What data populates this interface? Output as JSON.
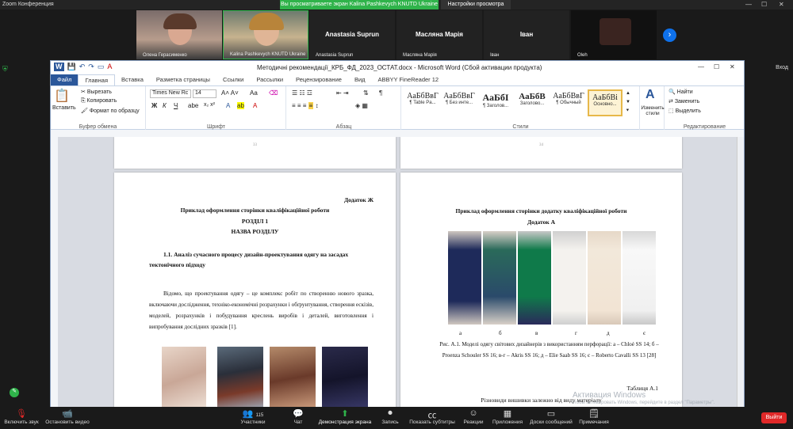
{
  "zoom": {
    "title": "Zoom Конференция",
    "sharing_banner": "Вы просматриваете экран Kalina Pashkevych KNUTD Ukraine",
    "view_options": "Настройки просмотра",
    "right_label": "Вход",
    "participants": [
      {
        "name": "Олена Герасименко"
      },
      {
        "name": "Kalina Pashkevych KNUTD Ukraine"
      },
      {
        "name": "Anastasia Suprun",
        "display": "Anastasia Suprun"
      },
      {
        "name": "Масляна Марія",
        "display": "Масляна Марія"
      },
      {
        "name": "Іван",
        "display": "Іван"
      },
      {
        "name": "Oleh"
      }
    ],
    "toolbar": {
      "mute": "Включить звук",
      "video": "Остановить видео",
      "participants": "Участники",
      "participants_count": "115",
      "chat": "Чат",
      "share": "Демонстрация экрана",
      "record": "Запись",
      "subtitles": "Показать субтитры",
      "reactions": "Реакции",
      "apps": "Приложения",
      "whiteboard": "Доски сообщений",
      "notes": "Примечания",
      "exit": "Выйти"
    },
    "watermark": "Активация Windows",
    "watermark_sub": "Чтобы активировать Windows, перейдите в раздел \"Параметры\"."
  },
  "word": {
    "title": "Методичні рекомендації_КРБ_ФД_2023_ОСТАТ.docx - Microsoft Word (Сбой активации продукта)",
    "tabs": [
      "Файл",
      "Главная",
      "Вставка",
      "Разметка страницы",
      "Ссылки",
      "Рассылки",
      "Рецензирование",
      "Вид",
      "ABBYY FineReader 12"
    ],
    "clipboard": {
      "paste": "Вставить",
      "cut": "Вырезать",
      "copy": "Копировать",
      "format": "Формат по образцу",
      "label": "Буфер обмена"
    },
    "font": {
      "name": "Times New Rc",
      "size": "14",
      "label": "Шрифт"
    },
    "paragraph_label": "Абзац",
    "styles_label": "Стили",
    "styles": [
      {
        "sample": "АаБбВвГ",
        "name": "¶ Table Pa..."
      },
      {
        "sample": "АаБбВвГ",
        "name": "¶ Без инте..."
      },
      {
        "sample": "АаБбI",
        "name": "¶ Заголов..."
      },
      {
        "sample": "АаБбВ",
        "name": "Заголово..."
      },
      {
        "sample": "АаБбВвГ",
        "name": "¶ Обычный"
      },
      {
        "sample": "АаБбВі",
        "name": "Основно..."
      }
    ],
    "change_styles": "Изменить стили",
    "editing": {
      "find": "Найти",
      "replace": "Заменить",
      "select": "Выделить",
      "label": "Редактирование"
    },
    "page_nums": {
      "left": "33",
      "right": "34"
    }
  },
  "doc_left": {
    "appendix": "Додаток Ж",
    "heading": "Приклад оформлення сторінки кваліфікаційної роботи",
    "section": "РОЗДІЛ 1",
    "section_name": "НАЗВА РОЗДІЛУ",
    "subsection_line1": "1.1.  Аналіз сучасного процесу дизайн-проектування одягу на засадах",
    "subsection_line2": "тектонічного підходу",
    "body": "Відомо, що проектування одягу – це комплекс робіт по створенню нового зразка, включаючи дослідження, техніко-економічні розрахунки і обґрунтування, створення ескізів, моделей, розрахунків і побудування креслень виробів і деталей, виготовлення і випробування дослідних зразків [1]."
  },
  "doc_right": {
    "heading": "Приклад оформлення сторінки додатку кваліфікаційної роботи",
    "appendix": "Додаток А",
    "labels": [
      "а",
      "б",
      "в",
      "г",
      "д",
      "є"
    ],
    "caption": "Рис. А.1. Моделі одягу світових дизайнерів з використанням перфорації: а – Chloé SS 14; б – Proenza Schouler SS 16; в-г – Akris SS 16; д – Elie Saab SS 16; є – Roberto Cavalli SS 13 [28]",
    "table_label": "Таблиця А.1",
    "table_title": "Різновиди вишивки залежно від виду матеріалу"
  }
}
